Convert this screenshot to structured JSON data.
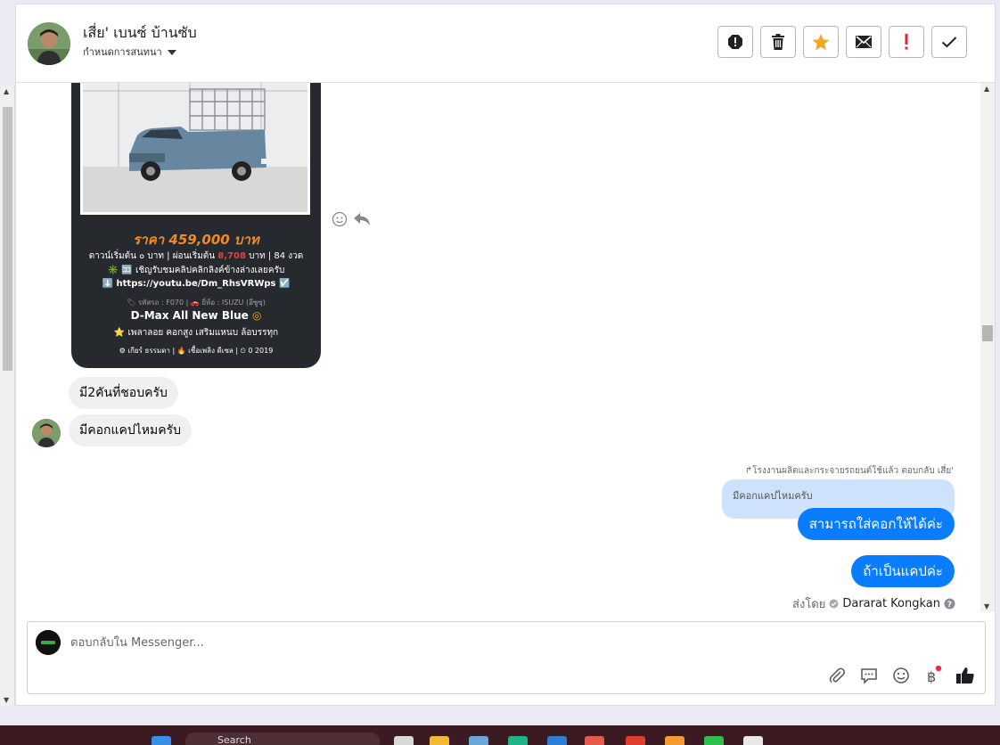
{
  "header": {
    "contact_name": "เสี่ย' เบนซ์ บ้านซับ",
    "conversation_setting_label": "กำหนดการสนทนา",
    "toolbar_icons": [
      "alert-octagon-icon",
      "trash-icon",
      "star-icon",
      "envelope-icon",
      "exclamation-icon",
      "check-icon"
    ],
    "star_color": "#f5a623",
    "exclamation_color": "#e0242b"
  },
  "product_card": {
    "price_text": "ราคา 459,000 บาท",
    "line2_pre": "ดาวน์เริ่มต้น ๐ บาท | ผ่อนเริ่มต้น ",
    "line2_highlight": "8,708",
    "line2_post": " บาท | 84 งวด",
    "line3": "✳️ 🈁 เชิญรับชมคลิปคลิกลิงค์ข้างล่างเลยครับ",
    "link": "⬇️ https://youtu.be/Dm_RhsVRWps ☑️",
    "meta": "🏷 รหัสรถ : F070 | 🚗 ยี่ห้อ : ISUZU (อีซูซุ)",
    "model": "D-Max All New Blue",
    "features": "⭐ เพลาลอย คอกสูง เสริมแหนบ ล้อบรรทุก",
    "specs": "⚙ เกียร์ ธรรมดา  |  🔥 เชื้อเพลิง ดีเซล  |  ⏲ 0 2019"
  },
  "messages": {
    "incoming_1": "มี2คันที่ชอบครับ",
    "incoming_2": "มีคอกแคปไหมครับ",
    "reply_meta": "↱โรงงานผลิตและกระจายรถยนต์ใช้แล้ว ตอบกลับ เสี่ย'",
    "quoted": "มีคอกแคปไหมครับ",
    "outgoing_1": "สามารถใส่คอกให้ได้ค่ะ",
    "outgoing_2": "ถ้าเป็นแคปค่ะ",
    "sent_by_label": "ส่งโดย",
    "sent_by_name": "Dararat Kongkan"
  },
  "composer": {
    "placeholder": "ตอบกลับใน Messenger...",
    "icons": [
      "paperclip-icon",
      "saved-reply-icon",
      "emoji-icon",
      "baht-payment-icon",
      "like-icon"
    ]
  },
  "taskbar": {
    "search_label": "Search"
  },
  "colors": {
    "outgoing_bubble": "#0a7cff",
    "quoted_bubble": "#cfe2fb",
    "incoming_bubble": "#f0f0f0",
    "price_orange": "#f08a24"
  }
}
